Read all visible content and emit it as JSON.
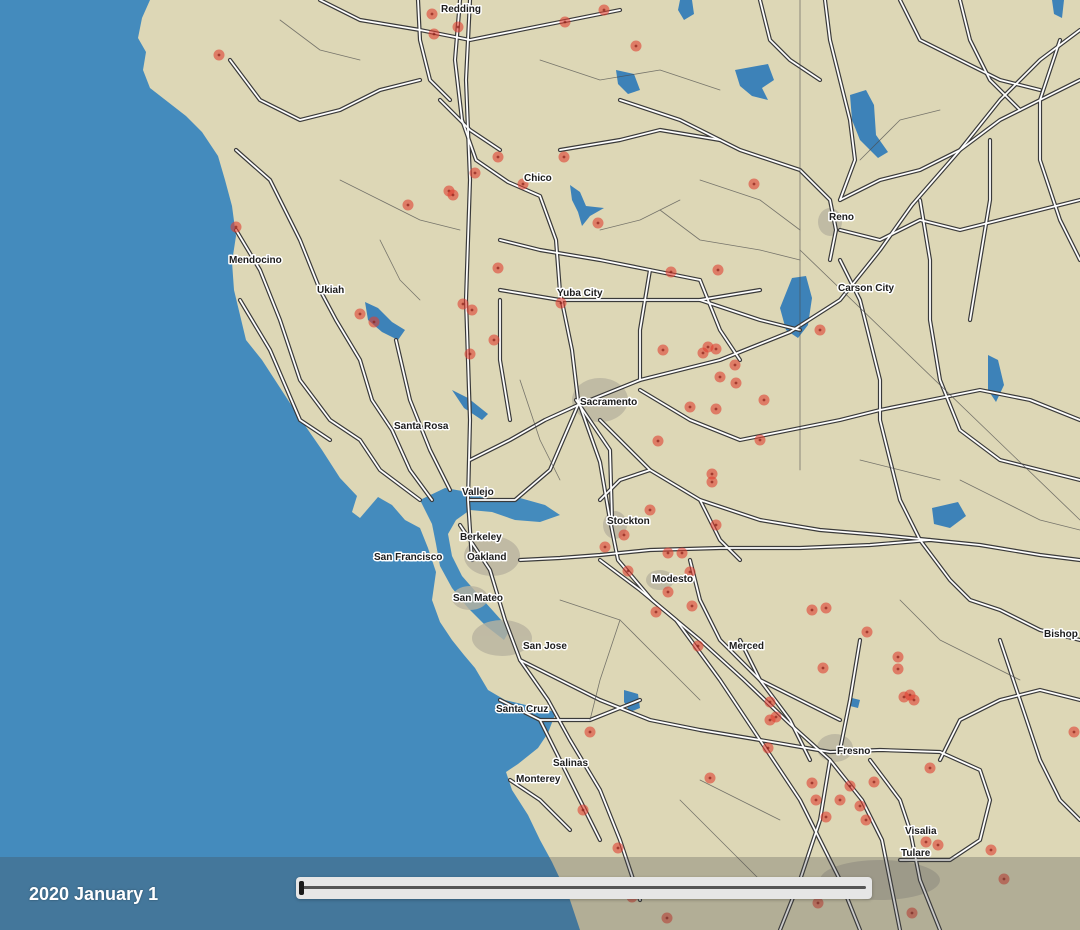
{
  "map": {
    "colors": {
      "ocean": "#448bbd",
      "land": "#ddd7b6",
      "road_casing": "#3a3a3a",
      "road_fill": "#ffffff",
      "urban": "#b9b4a0",
      "water": "#3d82b8",
      "fire": "#e04030"
    },
    "cities": [
      {
        "id": "redding",
        "name": "Redding"
      },
      {
        "id": "chico",
        "name": "Chico"
      },
      {
        "id": "reno",
        "name": "Reno"
      },
      {
        "id": "mendocino",
        "name": "Mendocino"
      },
      {
        "id": "ukiah",
        "name": "Ukiah"
      },
      {
        "id": "yuba-city",
        "name": "Yuba City"
      },
      {
        "id": "carson-city",
        "name": "Carson City"
      },
      {
        "id": "sacramento",
        "name": "Sacramento"
      },
      {
        "id": "santa-rosa",
        "name": "Santa Rosa"
      },
      {
        "id": "vallejo",
        "name": "Vallejo"
      },
      {
        "id": "stockton",
        "name": "Stockton"
      },
      {
        "id": "berkeley",
        "name": "Berkeley"
      },
      {
        "id": "san-francisco",
        "name": "San Francisco"
      },
      {
        "id": "oakland",
        "name": "Oakland"
      },
      {
        "id": "modesto",
        "name": "Modesto"
      },
      {
        "id": "san-mateo",
        "name": "San Mateo"
      },
      {
        "id": "bishop",
        "name": "Bishop"
      },
      {
        "id": "san-jose",
        "name": "San Jose"
      },
      {
        "id": "merced",
        "name": "Merced"
      },
      {
        "id": "santa-cruz",
        "name": "Santa Cruz"
      },
      {
        "id": "fresno",
        "name": "Fresno"
      },
      {
        "id": "salinas",
        "name": "Salinas"
      },
      {
        "id": "monterey",
        "name": "Monterey"
      },
      {
        "id": "visalia",
        "name": "Visalia"
      },
      {
        "id": "tulare",
        "name": "Tulare"
      }
    ]
  },
  "timeline": {
    "date_label": "2020 January 1",
    "progress": 0.0
  }
}
